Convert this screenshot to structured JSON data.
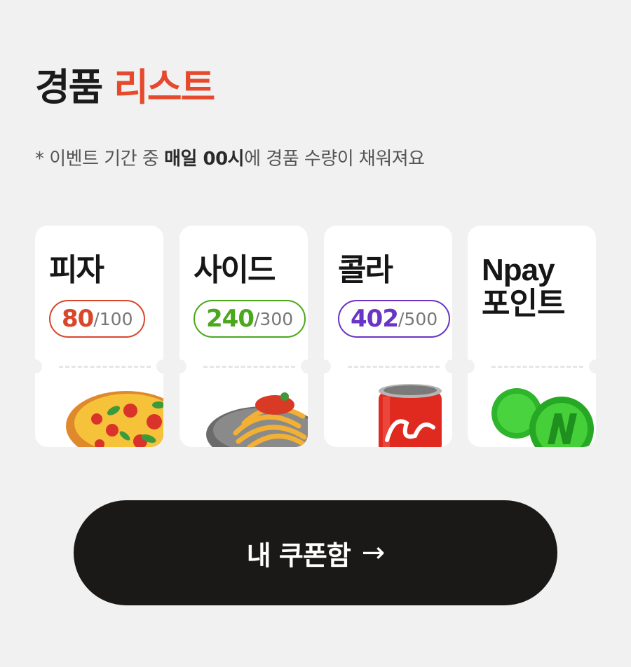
{
  "header": {
    "title_main": "경품",
    "title_accent": "리스트",
    "notice_prefix": "* 이벤트 기간 중 ",
    "notice_bold": "매일 00시",
    "notice_suffix": "에 경품 수량이 채워져요"
  },
  "prizes": [
    {
      "name": "피자",
      "remaining": "80",
      "total": "/100",
      "color": "#d9472b"
    },
    {
      "name": "사이드",
      "remaining": "240",
      "total": "/300",
      "color": "#4ba71c"
    },
    {
      "name": "콜라",
      "remaining": "402",
      "total": "/500",
      "color": "#6a34c6"
    },
    {
      "name_line1": "Npay",
      "name_line2": "포인트"
    }
  ],
  "cta": {
    "label": "내 쿠폰함",
    "arrow": "→"
  }
}
